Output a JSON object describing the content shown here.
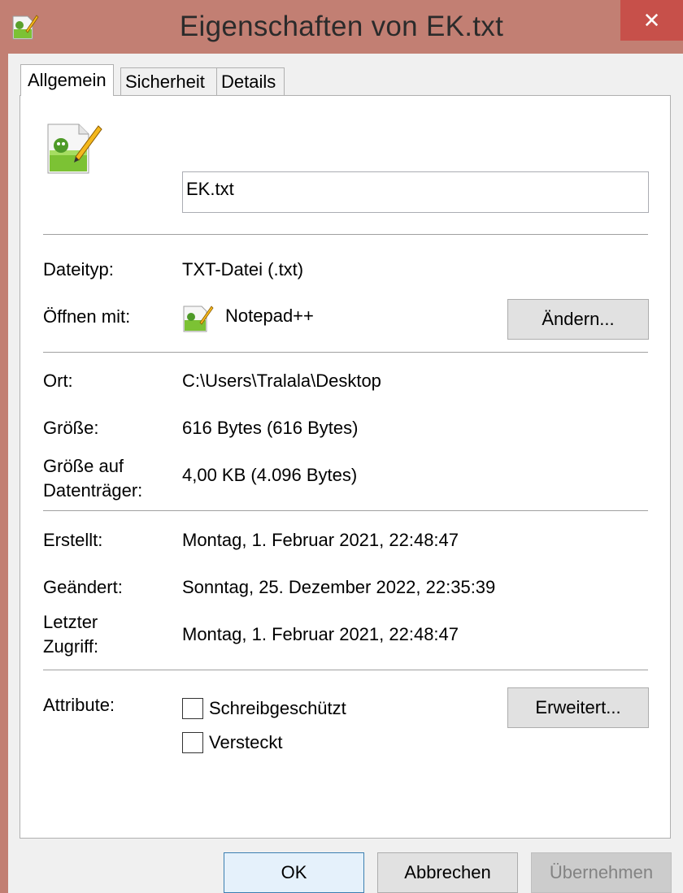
{
  "window": {
    "title": "Eigenschaften von EK.txt",
    "close_label": "✕"
  },
  "tabs": [
    {
      "label": "Allgemein",
      "active": true
    },
    {
      "label": "Sicherheit",
      "active": false
    },
    {
      "label": "Details",
      "active": false
    }
  ],
  "file": {
    "name": "EK.txt",
    "icon": "notepad-plus-plus-icon"
  },
  "fields": {
    "type_label": "Dateityp:",
    "type_value": "TXT-Datei (.txt)",
    "open_with_label": "Öffnen mit:",
    "open_with_value": "Notepad++",
    "change_button": "Ändern...",
    "location_label": "Ort:",
    "location_value": "C:\\Users\\Tralala\\Desktop",
    "size_label": "Größe:",
    "size_value": "616 Bytes (616 Bytes)",
    "size_on_disk_label_1": "Größe auf",
    "size_on_disk_label_2": "Datenträger:",
    "size_on_disk_value": "4,00 KB (4.096 Bytes)",
    "created_label": "Erstellt:",
    "created_value": "Montag, 1. Februar 2021, 22:48:47",
    "modified_label": "Geändert:",
    "modified_value": "Sonntag, 25. Dezember 2022, 22:35:39",
    "accessed_label_1": "Letzter",
    "accessed_label_2": "Zugriff:",
    "accessed_value": "Montag, 1. Februar 2021, 22:48:47",
    "attributes_label": "Attribute:",
    "readonly_label": "Schreibgeschützt",
    "readonly_checked": false,
    "hidden_label": "Versteckt",
    "hidden_checked": false,
    "advanced_button": "Erweitert..."
  },
  "buttons": {
    "ok": "OK",
    "cancel": "Abbrechen",
    "apply": "Übernehmen"
  },
  "colors": {
    "titlebar": "#c27f73",
    "close": "#c7504a",
    "ok_border": "#3c7fb1",
    "disabled_text": "#838383"
  }
}
